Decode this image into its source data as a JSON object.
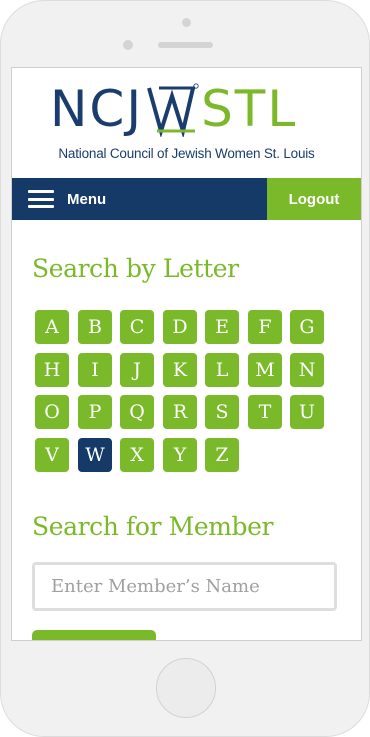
{
  "logo": {
    "left_text": "NCJ",
    "right_text": "STL",
    "subtitle": "National Council of Jewish Women St. Louis"
  },
  "nav": {
    "menu_label": "Menu",
    "logout_label": "Logout"
  },
  "letter_section": {
    "title": "Search by Letter",
    "letters": [
      "A",
      "B",
      "C",
      "D",
      "E",
      "F",
      "G",
      "H",
      "I",
      "J",
      "K",
      "L",
      "M",
      "N",
      "O",
      "P",
      "Q",
      "R",
      "S",
      "T",
      "U",
      "V",
      "W",
      "X",
      "Y",
      "Z"
    ],
    "active_letter": "W"
  },
  "member_section": {
    "title": "Search for Member",
    "placeholder": "Enter Member’s Name"
  },
  "colors": {
    "brand_green": "#7ab929",
    "brand_navy": "#153a68"
  }
}
